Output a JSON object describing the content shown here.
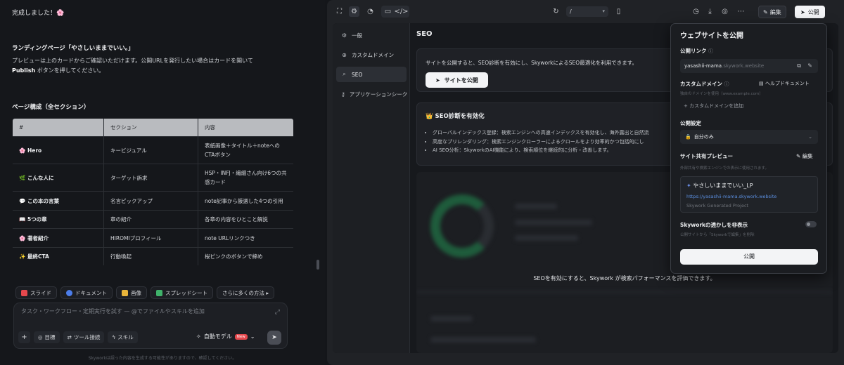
{
  "chat": {
    "done": "完成しました！🌸",
    "lp_title": "ランディングページ「やさしいままでいい。」",
    "lp_desc_1": "プレビューは上のカードからご確認いただけます。公開URLを発行したい場合はカードを開いて",
    "lp_desc_bold": "Publish",
    "lp_desc_2": " ボタンを押してください。",
    "pages_title": "ページ構成（全セクション）",
    "table": {
      "headers": [
        "#",
        "セクション",
        "内容"
      ],
      "rows": [
        [
          "🌸 Hero",
          "キービジュアル",
          "表紙画像＋タイトル＋noteへのCTAボタン"
        ],
        [
          "🌿 こんな人に",
          "ターゲット訴求",
          "HSP・INFJ・繊細さん向け6つの共感カード"
        ],
        [
          "💬 この本の言葉",
          "名言ピックアップ",
          "note記事から厳選した4つの引用"
        ],
        [
          "📖 5つの章",
          "章の紹介",
          "各章の内容をひとこと解説"
        ],
        [
          "🌸 著者紹介",
          "HIROMIプロフィール",
          "note URLリンクつき"
        ],
        [
          "✨ 最終CTA",
          "行動喚起",
          "桜ピンクのボタンで締め"
        ]
      ]
    },
    "chips": [
      {
        "label": "スライド",
        "color": "#e5484d"
      },
      {
        "label": "ドキュメント",
        "color": "#4c7dea"
      },
      {
        "label": "画像",
        "color": "#e8b43a"
      },
      {
        "label": "スプレッドシート",
        "color": "#3fb26a"
      },
      {
        "label": "さらに多くの方法 ▸",
        "color": ""
      }
    ],
    "composer_placeholder": "タスク・ワークフロー・定期実行を試す — @でファイルやスキルを追加",
    "tools": [
      "目標",
      "ツール接続",
      "スキル"
    ],
    "model": "自動モデル",
    "new_badge": "New",
    "disclaimer": "Skyworkは誤った内容を生成する可能性がありますので、確認してください。"
  },
  "topbar": {
    "url": "/",
    "edit": "編集",
    "publish": "公開"
  },
  "settings": {
    "nav": [
      "一般",
      "カスタムドメイン",
      "SEO",
      "アプリケーションシーク"
    ],
    "heading": "SEO",
    "card1_text": "サイトを公開すると、SEO診断を有効にし、SkyworkによるSEO最適化を利用できます。",
    "card1_button": "サイトを公開",
    "card2_title": "👑 SEO診断を有効化",
    "card2_items": [
      "グローバルインデックス登録：検索エンジンへの高速インデックスを有効化し、海外露出と自然流",
      "高度なプリレンダリング：検索エンジンクローラーによるクロールをより効率的かつ包括的にし",
      "AI SEO分析：SkyworkのAI機能により、検索順位を継続的に分析・改善します。"
    ],
    "blur_message": "SEOを有効にすると、Skywork が検索パフォーマンスを評価できます。"
  },
  "popover": {
    "title": "ウェブサイトを公開",
    "public_link_label": "公開リンク",
    "slug": "yasashii-mama",
    "domain_suffix": ".skywork.website",
    "custom_domain_label": "カスタムドメイン",
    "help_doc": "ヘルプドキュメント",
    "custom_domain_hint": "独自のドメインを使用（www.example.com）",
    "add_domain": "+ カスタムドメインを追加",
    "settings_label": "公開設定",
    "visibility": "自分のみ",
    "share_preview_label": "サイト共有プレビュー",
    "edit": "編集",
    "share_hint": "外部共有や検索エンジンでの表示に使用されます。",
    "share_title": "やさしいままでいい_LP",
    "share_url": "https://yasashii-mama.skywork.website",
    "share_sub": "Skywork Generated Project",
    "watermark_label": "Skyworkの透かしを非表示",
    "watermark_hint": "公開サイトから「Skyworkで編集」を削除",
    "publish_button": "公開"
  }
}
